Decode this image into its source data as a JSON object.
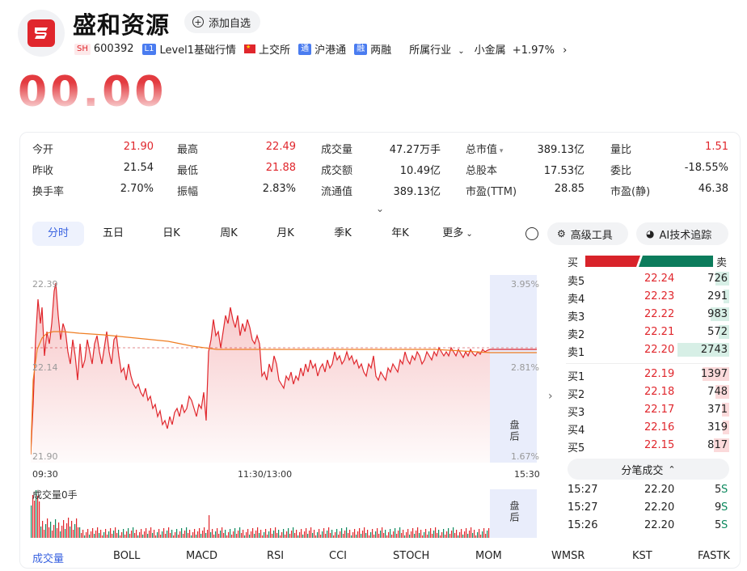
{
  "header": {
    "name": "盛和资源",
    "add_watchlist": "添加自选",
    "exchange_tag": "SH",
    "code": "600392",
    "l1_tag": "L1",
    "l1_label": "Level1基础行情",
    "exchange": "上交所",
    "hk_tag": "通",
    "hk_connect": "沪港通",
    "margin_tag": "融",
    "margin": "两融",
    "industry_label": "所属行业",
    "industry_name": "小金属",
    "industry_change": "+1.97%"
  },
  "price_display": "00.00",
  "stats": [
    {
      "label": "今开",
      "value": "21.90",
      "color": "red"
    },
    {
      "label": "最高",
      "value": "22.49",
      "color": "red"
    },
    {
      "label": "成交量",
      "value": "47.27万手",
      "color": "black"
    },
    {
      "label": "总市值",
      "value": "389.13亿",
      "color": "black"
    },
    {
      "label": "量比",
      "value": "1.51",
      "color": "red"
    },
    {
      "label": "昨收",
      "value": "21.54",
      "color": "black"
    },
    {
      "label": "最低",
      "value": "21.88",
      "color": "red"
    },
    {
      "label": "成交额",
      "value": "10.49亿",
      "color": "black"
    },
    {
      "label": "总股本",
      "value": "17.53亿",
      "color": "black"
    },
    {
      "label": "委比",
      "value": "-18.55%",
      "color": "black"
    },
    {
      "label": "换手率",
      "value": "2.70%",
      "color": "black"
    },
    {
      "label": "振幅",
      "value": "2.83%",
      "color": "black"
    },
    {
      "label": "流通值",
      "value": "389.13亿",
      "color": "black"
    },
    {
      "label": "市盈(TTM)",
      "value": "28.85",
      "color": "black"
    },
    {
      "label": "市盈(静)",
      "value": "46.38",
      "color": "black"
    }
  ],
  "tabs": [
    "分时",
    "五日",
    "日K",
    "周K",
    "月K",
    "季K",
    "年K",
    "更多"
  ],
  "tools": {
    "advanced": "高级工具",
    "ai": "AI技术追踪"
  },
  "chart": {
    "y_labels": [
      "22.39",
      "22.14",
      "21.90"
    ],
    "pct_labels": [
      "3.95%",
      "2.81%",
      "1.67%"
    ],
    "time_labels": [
      "09:30",
      "11:30/13:00",
      "15:30"
    ],
    "after_hours": "盘后",
    "volume_label": "成交量0手"
  },
  "orderbook": {
    "buy_label": "买",
    "sell_label": "卖",
    "sells": [
      {
        "label": "卖5",
        "price": "22.24",
        "vol": "726",
        "frac": 0.26
      },
      {
        "label": "卖4",
        "price": "22.23",
        "vol": "291",
        "frac": 0.11
      },
      {
        "label": "卖3",
        "price": "22.22",
        "vol": "983",
        "frac": 0.36
      },
      {
        "label": "卖2",
        "price": "22.21",
        "vol": "572",
        "frac": 0.21
      },
      {
        "label": "卖1",
        "price": "22.20",
        "vol": "2743",
        "frac": 1.0
      }
    ],
    "buys": [
      {
        "label": "买1",
        "price": "22.19",
        "vol": "1397",
        "frac": 0.51
      },
      {
        "label": "买2",
        "price": "22.18",
        "vol": "748",
        "frac": 0.27
      },
      {
        "label": "买3",
        "price": "22.17",
        "vol": "371",
        "frac": 0.14
      },
      {
        "label": "买4",
        "price": "22.16",
        "vol": "319",
        "frac": 0.12
      },
      {
        "label": "买5",
        "price": "22.15",
        "vol": "817",
        "frac": 0.3
      }
    ]
  },
  "ticks": {
    "title": "分笔成交",
    "rows": [
      {
        "time": "15:27",
        "price": "22.20",
        "vol": "5",
        "side": "S"
      },
      {
        "time": "15:27",
        "price": "22.20",
        "vol": "9",
        "side": "S"
      },
      {
        "time": "15:26",
        "price": "22.20",
        "vol": "5",
        "side": "S"
      }
    ]
  },
  "indicators": [
    "成交量",
    "BOLL",
    "MACD",
    "RSI",
    "CCI",
    "STOCH",
    "MOM",
    "WMSR",
    "KST",
    "FASTK"
  ],
  "chart_data": {
    "type": "line",
    "x": [
      "09:30",
      "11:30/13:00",
      "15:30"
    ],
    "series": [],
    "ylim": [
      21.9,
      22.39
    ],
    "y_ticks": [
      22.39,
      22.14,
      21.9
    ],
    "pct_ticks": [
      "3.95%",
      "2.81%",
      "1.67%"
    ],
    "reference_close": 21.54,
    "colors": {
      "price": "#e0262c",
      "avg": "#ef7d22",
      "up": "#e0262c",
      "down": "#0e8a5f"
    }
  }
}
